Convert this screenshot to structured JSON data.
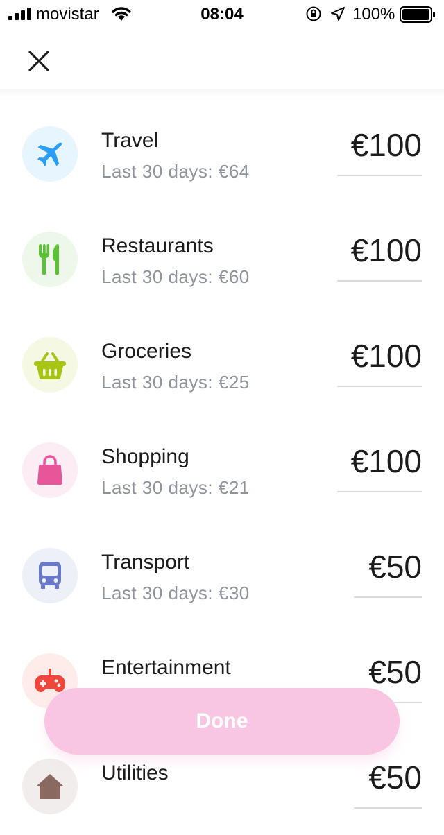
{
  "status_bar": {
    "carrier": "movistar",
    "time": "08:04",
    "battery": "100%"
  },
  "categories": [
    {
      "name": "Travel",
      "spent": "Last 30 days: €64",
      "budget": "€100",
      "icon": "airplane-icon",
      "icon_color": "#2a9df4",
      "bg_color": "#e6f5fe"
    },
    {
      "name": "Restaurants",
      "spent": "Last 30 days: €60",
      "budget": "€100",
      "icon": "fork-knife-icon",
      "icon_color": "#5bc236",
      "bg_color": "#eef8ea"
    },
    {
      "name": "Groceries",
      "spent": "Last 30 days: €25",
      "budget": "€100",
      "icon": "basket-icon",
      "icon_color": "#a8c414",
      "bg_color": "#f5f9e4"
    },
    {
      "name": "Shopping",
      "spent": "Last 30 days: €21",
      "budget": "€100",
      "icon": "shopping-bag-icon",
      "icon_color": "#e8569a",
      "bg_color": "#fcedf4"
    },
    {
      "name": "Transport",
      "spent": "Last 30 days: €30",
      "budget": "€50",
      "icon": "bus-icon",
      "icon_color": "#6a78c8",
      "bg_color": "#eef0f8"
    },
    {
      "name": "Entertainment",
      "spent": "",
      "budget": "€50",
      "icon": "gamepad-icon",
      "icon_color": "#f0463c",
      "bg_color": "#fdecea"
    },
    {
      "name": "Utilities",
      "spent": "",
      "budget": "€50",
      "icon": "house-icon",
      "icon_color": "#8a6a60",
      "bg_color": "#f1edec"
    }
  ],
  "done_label": "Done"
}
